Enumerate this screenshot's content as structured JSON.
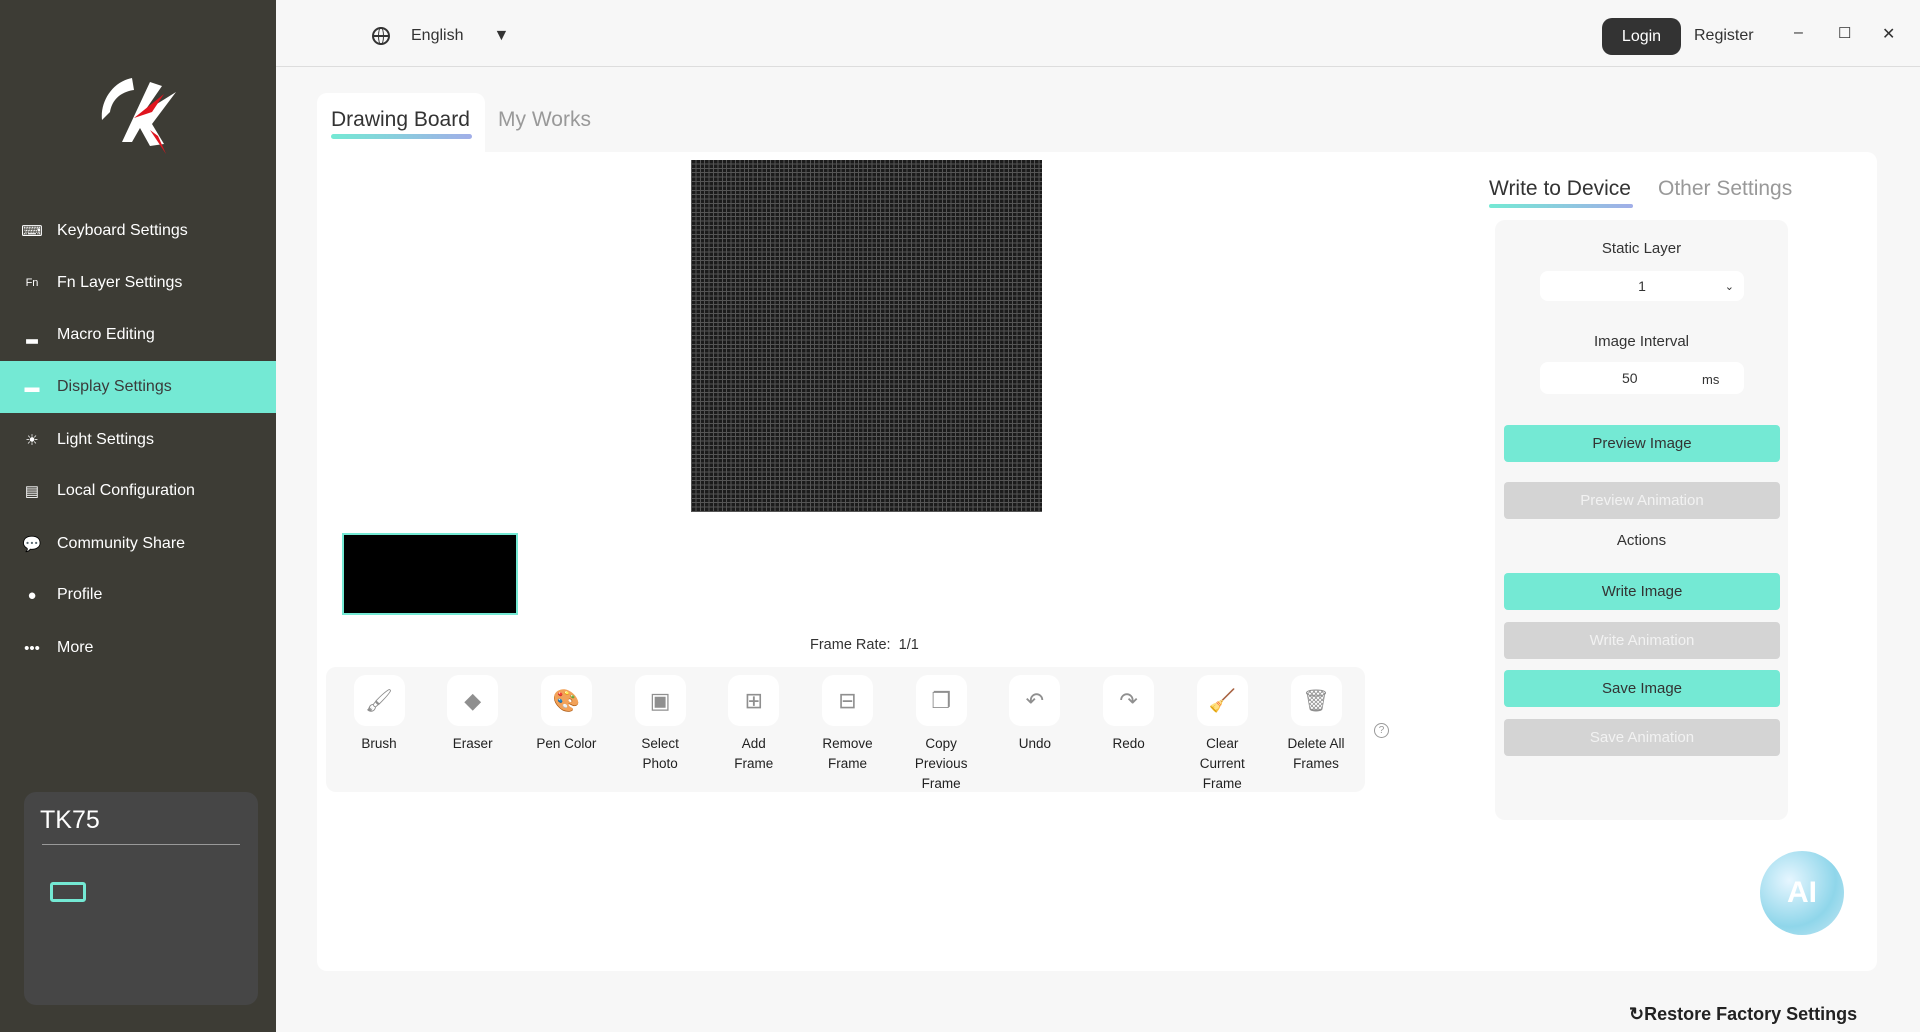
{
  "header": {
    "language": "English",
    "login": "Login",
    "register": "Register",
    "minimize": "–",
    "maximize": "☐",
    "close": "✕"
  },
  "sidebar": {
    "items": [
      {
        "label": "Keyboard Settings",
        "icon": "keyboard-icon"
      },
      {
        "label": "Fn Layer Settings",
        "icon": "fn-icon"
      },
      {
        "label": "Macro Editing",
        "icon": "macro-icon"
      },
      {
        "label": "Display Settings",
        "icon": "monitor-icon",
        "active": true
      },
      {
        "label": "Light Settings",
        "icon": "light-icon"
      },
      {
        "label": "Local Configuration",
        "icon": "archive-icon"
      },
      {
        "label": "Community Share",
        "icon": "chat-icon"
      },
      {
        "label": "Profile",
        "icon": "user-icon"
      },
      {
        "label": "More",
        "icon": "more-icon"
      }
    ],
    "device": {
      "name": "TK75"
    }
  },
  "tabs": {
    "drawing_board": "Drawing Board",
    "my_works": "My Works"
  },
  "board": {
    "frame_rate_label": "Frame Rate:",
    "frame_rate": "1/1"
  },
  "tools": [
    {
      "label": "Brush",
      "glyph": "🖌"
    },
    {
      "label": "Eraser",
      "glyph": "◆"
    },
    {
      "label": "Pen Color",
      "glyph": "🎨"
    },
    {
      "label": "Select Photo",
      "glyph": "▣"
    },
    {
      "label": "Add Frame",
      "glyph": "⊞"
    },
    {
      "label": "Remove Frame",
      "glyph": "⊟"
    },
    {
      "label": "Copy Previous Frame",
      "glyph": "❐"
    },
    {
      "label": "Undo",
      "glyph": "↶"
    },
    {
      "label": "Redo",
      "glyph": "↷"
    },
    {
      "label": "Clear Current Frame",
      "glyph": "🧹"
    },
    {
      "label": "Delete All Frames",
      "glyph": "🗑"
    }
  ],
  "right": {
    "tab_write": "Write to Device",
    "tab_other": "Other Settings",
    "static_layer_label": "Static Layer",
    "static_layer": "1",
    "interval_label": "Image Interval",
    "interval": "50",
    "interval_unit": "ms",
    "preview_image": "Preview Image",
    "preview_animation": "Preview Animation",
    "actions": "Actions",
    "write_image": "Write Image",
    "write_animation": "Write Animation",
    "save_image": "Save Image",
    "save_animation": "Save Animation"
  },
  "ai": "AI",
  "restore": "Restore Factory Settings",
  "colors": {
    "accent": "#74e9d4",
    "sidebar": "#3d3c35"
  }
}
